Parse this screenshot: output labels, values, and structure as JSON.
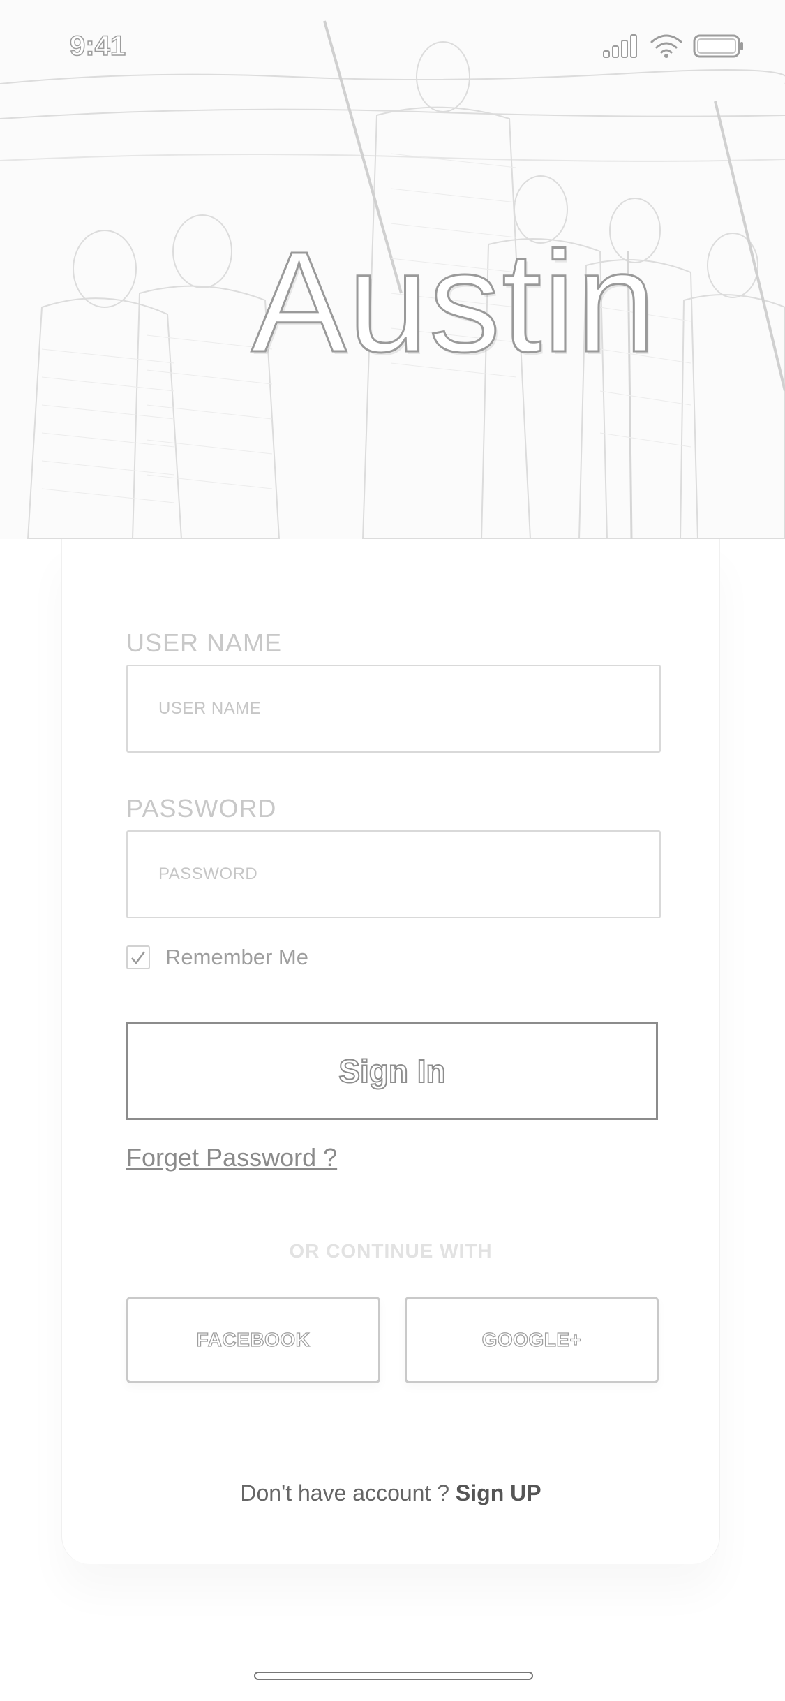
{
  "status_bar": {
    "time": "9:41"
  },
  "hero": {
    "title": "Austin"
  },
  "form": {
    "username_label": "USER NAME",
    "username_placeholder": "USER NAME",
    "password_label": "PASSWORD",
    "password_placeholder": "PASSWORD",
    "remember_label": "Remember Me",
    "remember_checked": true,
    "signin_label": "Sign In",
    "forgot_label": "Forget Password ?"
  },
  "social": {
    "divider_text": "OR CONTINUE WITH",
    "facebook_label": "FACEBOOK",
    "google_label": "GOOGLE+"
  },
  "footer": {
    "prompt": "Don't have account ?",
    "signup_label": "Sign UP"
  }
}
